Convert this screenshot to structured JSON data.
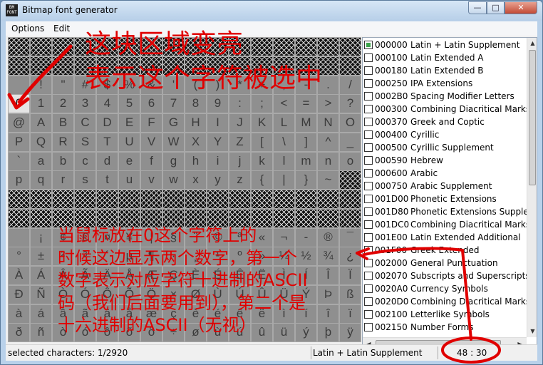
{
  "window": {
    "app_icon_text": "BM\nFONT",
    "title": "Bitmap font generator",
    "buttons": {
      "minimize": "—",
      "maximize": "□",
      "close": "✕"
    }
  },
  "menu": [
    "Options",
    "Edit"
  ],
  "char_grid": {
    "columns": 16,
    "rows": [
      [
        "",
        "",
        "",
        "",
        "",
        "",
        "",
        "",
        "",
        "",
        "",
        "",
        "",
        "",
        "",
        ""
      ],
      [
        "",
        "",
        "",
        "",
        "",
        "",
        "",
        "",
        "",
        "",
        "",
        "",
        "",
        "",
        "",
        ""
      ],
      [
        " ",
        "!",
        "\"",
        "#",
        "$",
        "%",
        "&",
        "'",
        "(",
        ")",
        "*",
        "+",
        ",",
        "-",
        ".",
        "/"
      ],
      [
        "0",
        "1",
        "2",
        "3",
        "4",
        "5",
        "6",
        "7",
        "8",
        "9",
        ":",
        ";",
        "<",
        "=",
        ">",
        "?"
      ],
      [
        "@",
        "A",
        "B",
        "C",
        "D",
        "E",
        "F",
        "G",
        "H",
        "I",
        "J",
        "K",
        "L",
        "M",
        "N",
        "O"
      ],
      [
        "P",
        "Q",
        "R",
        "S",
        "T",
        "U",
        "V",
        "W",
        "X",
        "Y",
        "Z",
        "[",
        "\\",
        "]",
        "^",
        "_"
      ],
      [
        "`",
        "a",
        "b",
        "c",
        "d",
        "e",
        "f",
        "g",
        "h",
        "i",
        "j",
        "k",
        "l",
        "m",
        "n",
        "o"
      ],
      [
        "p",
        "q",
        "r",
        "s",
        "t",
        "u",
        "v",
        "w",
        "x",
        "y",
        "z",
        "{",
        "|",
        "}",
        "~",
        ""
      ],
      [
        "",
        "",
        "",
        "",
        "",
        "",
        "",
        "",
        "",
        "",
        "",
        "",
        "",
        "",
        "",
        ""
      ],
      [
        "",
        "",
        "",
        "",
        "",
        "",
        "",
        "",
        "",
        "",
        "",
        "",
        "",
        "",
        "",
        ""
      ],
      [
        " ",
        "¡",
        "¢",
        "£",
        "¤",
        "¥",
        "¦",
        "§",
        "¨",
        "©",
        "ª",
        "«",
        "¬",
        "-",
        "®",
        "¯"
      ],
      [
        "°",
        "±",
        "²",
        "³",
        "´",
        "µ",
        "¶",
        "·",
        "¸",
        "¹",
        "º",
        "»",
        "¼",
        "½",
        "¾",
        "¿"
      ],
      [
        "À",
        "Á",
        "Â",
        "Ã",
        "Ä",
        "Å",
        "Æ",
        "Ç",
        "È",
        "É",
        "Ê",
        "Ë",
        "Ì",
        "Í",
        "Î",
        "Ï"
      ],
      [
        "Ð",
        "Ñ",
        "Ò",
        "Ó",
        "Ô",
        "Õ",
        "Ö",
        "×",
        "Ø",
        "Ù",
        "Ú",
        "Û",
        "Ü",
        "Ý",
        "Þ",
        "ß"
      ],
      [
        "à",
        "á",
        "â",
        "ã",
        "ä",
        "å",
        "æ",
        "ç",
        "è",
        "é",
        "ê",
        "ë",
        "ì",
        "í",
        "î",
        "ï"
      ],
      [
        "ð",
        "ñ",
        "ò",
        "ó",
        "ô",
        "õ",
        "ö",
        "÷",
        "ø",
        "ù",
        "ú",
        "û",
        "ü",
        "ý",
        "þ",
        "ÿ"
      ]
    ],
    "empty_cells": [
      [
        7,
        15
      ]
    ],
    "selected_cell": [
      3,
      0
    ]
  },
  "char_sets": [
    {
      "code": "000000",
      "name": "Latin + Latin Supplement",
      "checked": "partial"
    },
    {
      "code": "000100",
      "name": "Latin Extended A",
      "checked": "none"
    },
    {
      "code": "000180",
      "name": "Latin Extended B",
      "checked": "none"
    },
    {
      "code": "000250",
      "name": "IPA Extensions",
      "checked": "none"
    },
    {
      "code": "0002B0",
      "name": "Spacing Modifier Letters",
      "checked": "none"
    },
    {
      "code": "000300",
      "name": "Combining Diacritical Marks",
      "checked": "none"
    },
    {
      "code": "000370",
      "name": "Greek and Coptic",
      "checked": "none"
    },
    {
      "code": "000400",
      "name": "Cyrillic",
      "checked": "none"
    },
    {
      "code": "000500",
      "name": "Cyrillic Supplement",
      "checked": "none"
    },
    {
      "code": "000590",
      "name": "Hebrew",
      "checked": "none"
    },
    {
      "code": "000600",
      "name": "Arabic",
      "checked": "none"
    },
    {
      "code": "000750",
      "name": "Arabic Supplement",
      "checked": "none"
    },
    {
      "code": "001D00",
      "name": "Phonetic Extensions",
      "checked": "none"
    },
    {
      "code": "001D80",
      "name": "Phonetic Extensions Supple.",
      "checked": "none"
    },
    {
      "code": "001DC0",
      "name": "Combining Diacritical Marks",
      "checked": "none"
    },
    {
      "code": "001E00",
      "name": "Latin Extended Additional",
      "checked": "none"
    },
    {
      "code": "001F00",
      "name": "Greek Extended",
      "checked": "none"
    },
    {
      "code": "002000",
      "name": "General Punctuation",
      "checked": "none"
    },
    {
      "code": "002070",
      "name": "Subscripts and Superscripts",
      "checked": "none"
    },
    {
      "code": "0020A0",
      "name": "Currency Symbols",
      "checked": "none"
    },
    {
      "code": "0020D0",
      "name": "Combining Diacritical Marks",
      "checked": "none"
    },
    {
      "code": "002100",
      "name": "Letterlike Symbols",
      "checked": "none"
    },
    {
      "code": "002150",
      "name": "Number Forms",
      "checked": "none"
    }
  ],
  "status": {
    "selected": "selected characters: 1/2920",
    "charset": "Latin + Latin Supplement",
    "code": "48 : 30"
  },
  "annotations": {
    "top": [
      "这块区域变亮",
      "表示这个字符被选中"
    ],
    "mid": [
      "当鼠标放在0这个字符上的",
      "时候这边显示两个数字，第一个",
      "数字表示对应字符十进制的ASCII",
      "码（我们后面要用到），第二个是",
      "十六进制的ASCII（无视）"
    ],
    "color": "#e00000"
  },
  "colors": {
    "cell_bg": "#8f8f8f",
    "selected_bg": "#e4e4e4",
    "empty_bg": "#111111"
  }
}
